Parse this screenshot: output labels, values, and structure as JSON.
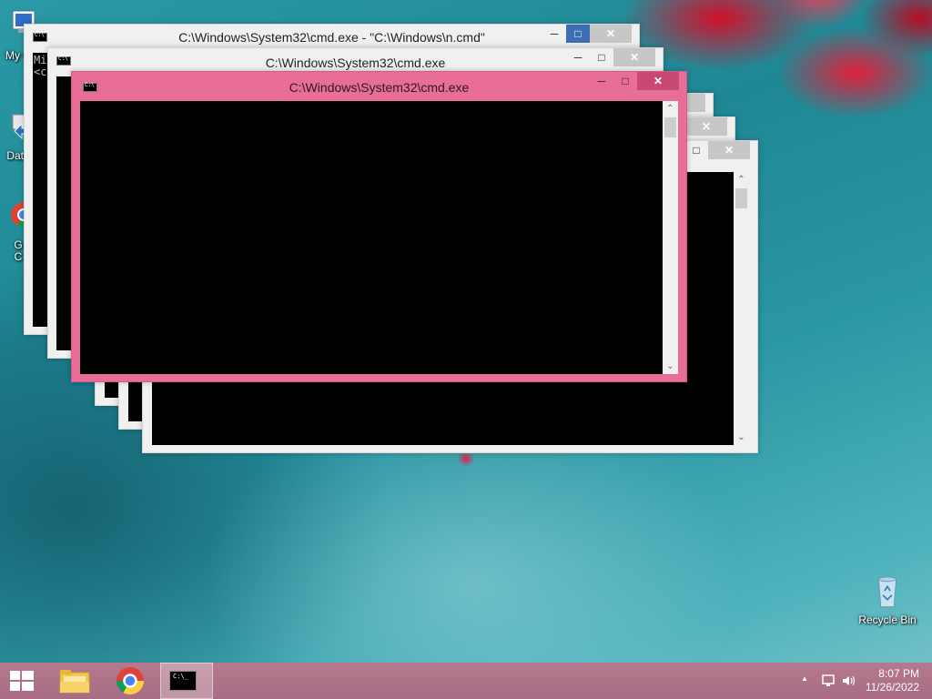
{
  "desktop": {
    "icons": [
      {
        "name": "my-computer",
        "label": "My C"
      },
      {
        "name": "data",
        "label": "Data"
      },
      {
        "name": "google-chrome",
        "label": "G\nC"
      },
      {
        "name": "recycle-bin",
        "label": "Recycle Bin"
      }
    ]
  },
  "windows": {
    "back_title": "C:\\Windows\\System32\\cmd.exe - \"C:\\Windows\\n.cmd\"",
    "back_console_text": "Mi\n<c",
    "second_title": "C:\\Windows\\System32\\cmd.exe",
    "front_title": "C:\\Windows\\System32\\cmd.exe",
    "minimize_glyph": "─",
    "maximize_glyph": "□",
    "close_glyph": "✕",
    "scroll_up_glyph": "⌃",
    "scroll_down_glyph": "⌄"
  },
  "taskbar": {
    "start_icon": "windows-logo-icon",
    "pinned": [
      {
        "name": "file-explorer",
        "icon": "folder-icon"
      },
      {
        "name": "chrome",
        "icon": "chrome-icon"
      },
      {
        "name": "command-prompt",
        "icon": "cmd-icon",
        "active": true
      }
    ],
    "tray": {
      "show_hidden_glyph": "▲",
      "time": "8:07 PM",
      "date": "11/26/2022"
    }
  },
  "colors": {
    "active_window_frame": "#e86e99",
    "taskbar": "#b5798f",
    "maximize_active": "#3d6eb4"
  }
}
